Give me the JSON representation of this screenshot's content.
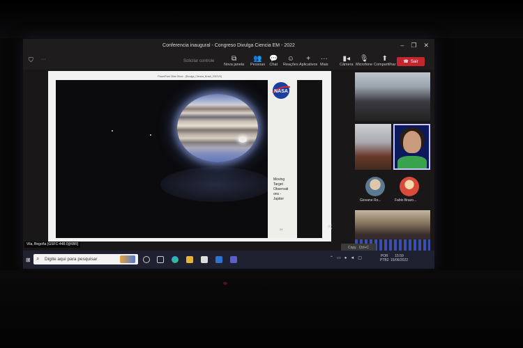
{
  "window": {
    "title": "Conferencia inaugural - Congreso Divulga Ciencia EM - 2022",
    "dots": "···"
  },
  "toolbar": {
    "request_control": "Solicitar controle",
    "new_window": "Nova janela",
    "people": "Pessoas",
    "chat": "Chat",
    "reactions": "Reações",
    "apps": "Aplicativos",
    "more": "Mais",
    "camera": "Câmera",
    "microphone": "Microfone",
    "share": "Compartilhar",
    "leave": "Sair"
  },
  "shared_content": {
    "caption": "PowerPoint Slide Show - [Divulga_Ciencia_Brasil_2022V3]",
    "slide_text_lines": [
      "Moving",
      "Target",
      "Observati",
      "ons -",
      "Jupiter"
    ],
    "slide_number": "24",
    "logo_text": "NASA"
  },
  "participants": [
    {
      "name": "Giovane Ro..."
    },
    {
      "name": "Fabio Brazo..."
    }
  ],
  "presenter_label": "Vila, Begoña (GSFC-448.0)[KBR]",
  "copy_popup": {
    "label": "Copy",
    "shortcut": "Ctrl+C"
  },
  "taskbar": {
    "search_placeholder": "Digite aqui para pesquisar",
    "lang_line1": "POR",
    "lang_line2": "PTB2",
    "time": "15:59",
    "date": "15/06/2022"
  }
}
